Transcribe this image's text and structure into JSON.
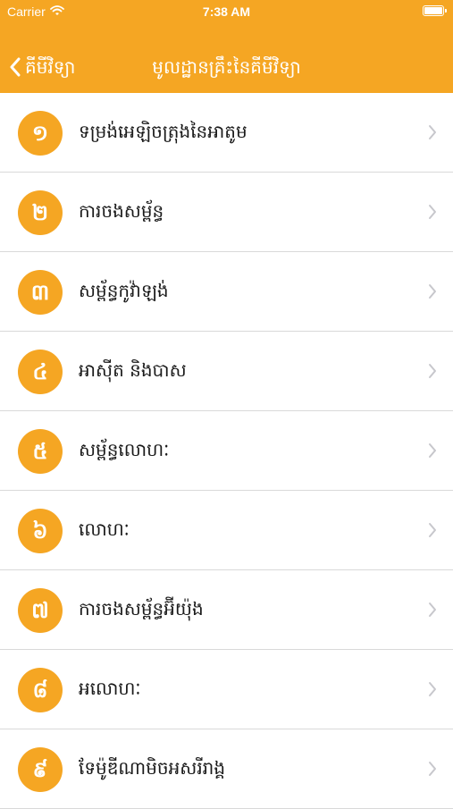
{
  "colors": {
    "accent": "#F5A623",
    "chevron": "#c7c7cc",
    "separator": "#d9d9d9",
    "label": "#1a1a1a"
  },
  "status_bar": {
    "carrier": "Carrier",
    "time": "7:38 AM",
    "icons": [
      "wifi-icon",
      "battery-icon"
    ]
  },
  "nav": {
    "back_label": "គីមីវិទ្យា",
    "back_icon": "chevron-left-icon",
    "title": "មូលដ្ឋានគ្រឹះនៃគីមីវិទ្យា"
  },
  "list": {
    "chevron_icon": "chevron-right-icon",
    "items": [
      {
        "number": "១",
        "label": "ទម្រង់អេឡិចត្រុងនៃអាតូម"
      },
      {
        "number": "២",
        "label": "ការចងសម្ព័ន្ធ"
      },
      {
        "number": "៣",
        "label": "សម្ព័ន្ធកូវ៉ាឡង់"
      },
      {
        "number": "៤",
        "label": "អាស៊ីត និងបាស"
      },
      {
        "number": "៥",
        "label": "សម្ព័ន្ធលោហៈ"
      },
      {
        "number": "៦",
        "label": "លោហៈ"
      },
      {
        "number": "៧",
        "label": "ការចងសម្ព័ន្ធអ៊ីយ៉ុង"
      },
      {
        "number": "៨",
        "label": "អលោហៈ"
      },
      {
        "number": "៩",
        "label": "ទែម៉ូឌីណាមិចអសរីរាង្គ"
      }
    ]
  }
}
